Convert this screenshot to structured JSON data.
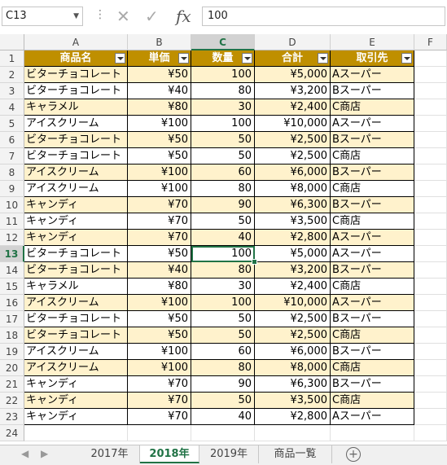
{
  "formula_bar": {
    "name_box": "C13",
    "formula": "100",
    "cancel_glyph": "✕",
    "confirm_glyph": "✓",
    "fx_label": "fx"
  },
  "columns": [
    "A",
    "B",
    "C",
    "D",
    "E",
    "F"
  ],
  "header_row": [
    "商品名",
    "単価",
    "数量",
    "合計",
    "取引先"
  ],
  "rows": [
    [
      "ビターチョコレート",
      "¥50",
      "100",
      "¥5,000",
      "Aスーパー"
    ],
    [
      "ビターチョコレート",
      "¥40",
      "80",
      "¥3,200",
      "Bスーパー"
    ],
    [
      "キャラメル",
      "¥80",
      "30",
      "¥2,400",
      "C商店"
    ],
    [
      "アイスクリーム",
      "¥100",
      "100",
      "¥10,000",
      "Aスーパー"
    ],
    [
      "ビターチョコレート",
      "¥50",
      "50",
      "¥2,500",
      "Bスーパー"
    ],
    [
      "ビターチョコレート",
      "¥50",
      "50",
      "¥2,500",
      "C商店"
    ],
    [
      "アイスクリーム",
      "¥100",
      "60",
      "¥6,000",
      "Bスーパー"
    ],
    [
      "アイスクリーム",
      "¥100",
      "80",
      "¥8,000",
      "C商店"
    ],
    [
      "キャンディ",
      "¥70",
      "90",
      "¥6,300",
      "Bスーパー"
    ],
    [
      "キャンディ",
      "¥70",
      "50",
      "¥3,500",
      "C商店"
    ],
    [
      "キャンディ",
      "¥70",
      "40",
      "¥2,800",
      "Aスーパー"
    ],
    [
      "ビターチョコレート",
      "¥50",
      "100",
      "¥5,000",
      "Aスーパー"
    ],
    [
      "ビターチョコレート",
      "¥40",
      "80",
      "¥3,200",
      "Bスーパー"
    ],
    [
      "キャラメル",
      "¥80",
      "30",
      "¥2,400",
      "C商店"
    ],
    [
      "アイスクリーム",
      "¥100",
      "100",
      "¥10,000",
      "Aスーパー"
    ],
    [
      "ビターチョコレート",
      "¥50",
      "50",
      "¥2,500",
      "Bスーパー"
    ],
    [
      "ビターチョコレート",
      "¥50",
      "50",
      "¥2,500",
      "C商店"
    ],
    [
      "アイスクリーム",
      "¥100",
      "60",
      "¥6,000",
      "Bスーパー"
    ],
    [
      "アイスクリーム",
      "¥100",
      "80",
      "¥8,000",
      "C商店"
    ],
    [
      "キャンディ",
      "¥70",
      "90",
      "¥6,300",
      "Bスーパー"
    ],
    [
      "キャンディ",
      "¥70",
      "50",
      "¥3,500",
      "C商店"
    ],
    [
      "キャンディ",
      "¥70",
      "40",
      "¥2,800",
      "Aスーパー"
    ]
  ],
  "row_numbers": [
    "1",
    "2",
    "3",
    "4",
    "5",
    "6",
    "7",
    "8",
    "9",
    "10",
    "11",
    "12",
    "13",
    "14",
    "15",
    "16",
    "17",
    "18",
    "19",
    "20",
    "21",
    "22",
    "23",
    "24"
  ],
  "active_cell": "C13",
  "sheet_tabs": [
    "2017年",
    "2018年",
    "2019年",
    "商品一覧"
  ],
  "active_tab": "2018年",
  "colors": {
    "header_fill": "#bf8f00",
    "band_fill": "#fff2cc",
    "accent": "#217346"
  }
}
